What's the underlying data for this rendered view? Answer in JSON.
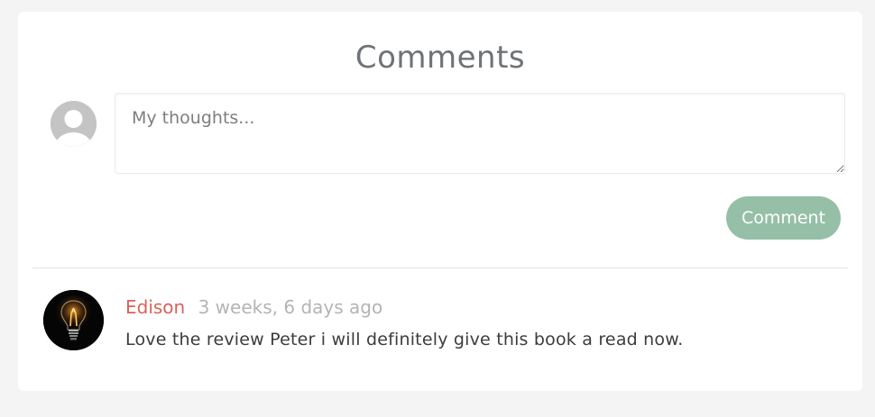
{
  "comments_section": {
    "title": "Comments",
    "new_comment": {
      "placeholder": "My thoughts...",
      "value": "",
      "submit_label": "Comment",
      "avatar_icon": "default-user-icon"
    },
    "comments": [
      {
        "author": "Edison",
        "timestamp": "3 weeks, 6 days ago",
        "text": "Love the review Peter i will definitely give this book a read now.",
        "avatar_icon": "lightbulb-icon"
      }
    ]
  },
  "colors": {
    "background": "#f4f4f4",
    "card": "#ffffff",
    "title": "#6f7377",
    "button": "#95bfa6",
    "author": "#d9625a",
    "timestamp": "#b4b4b4",
    "text": "#3c3c3c"
  }
}
